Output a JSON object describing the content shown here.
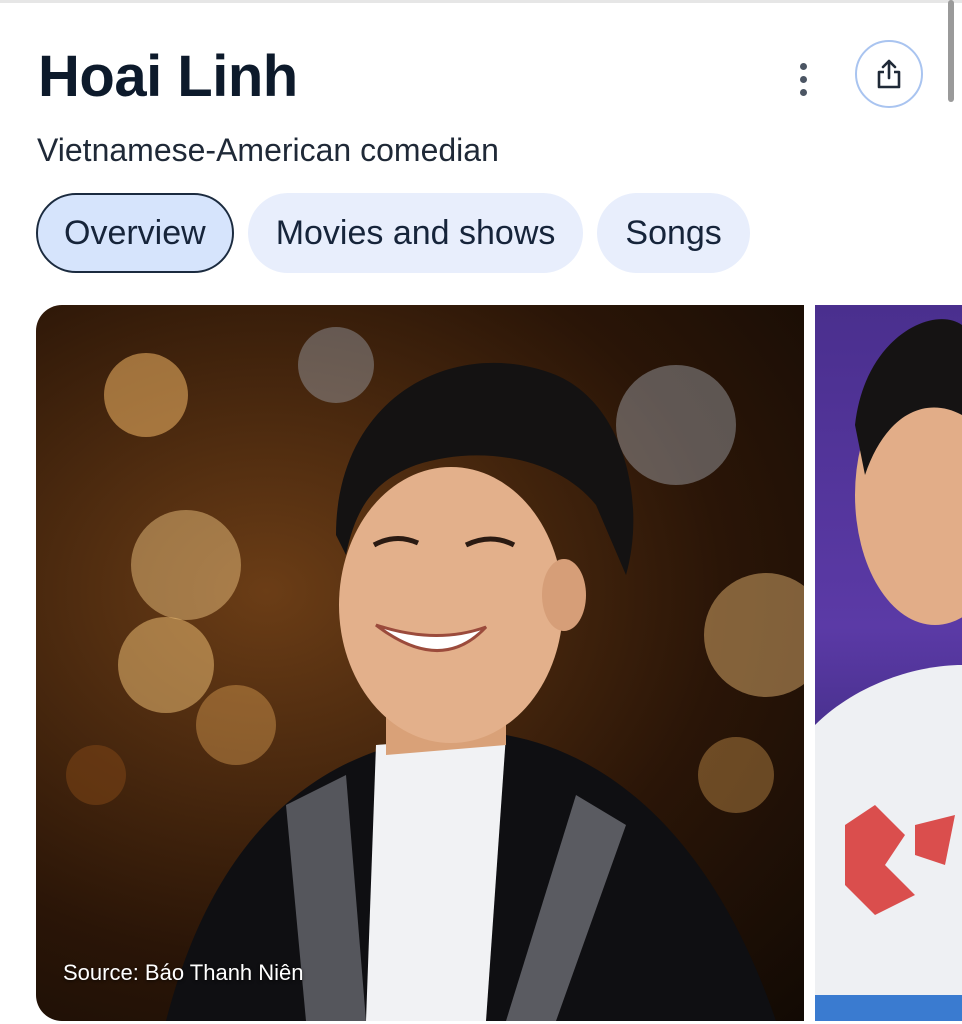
{
  "entity": {
    "title": "Hoai Linh",
    "subtitle": "Vietnamese-American comedian"
  },
  "actions": {
    "more_icon": "more-vert-icon",
    "share_icon": "share-icon"
  },
  "tabs": [
    {
      "label": "Overview",
      "active": true
    },
    {
      "label": "Movies and shows",
      "active": false
    },
    {
      "label": "Songs",
      "active": false
    }
  ],
  "images": {
    "main_source": "Source: Báo Thanh Niên"
  },
  "colors": {
    "title": "#0d1a2b",
    "tab_bg": "#e8eefc",
    "tab_active_bg": "#d6e4fc",
    "share_ring": "#a9c4f0"
  }
}
